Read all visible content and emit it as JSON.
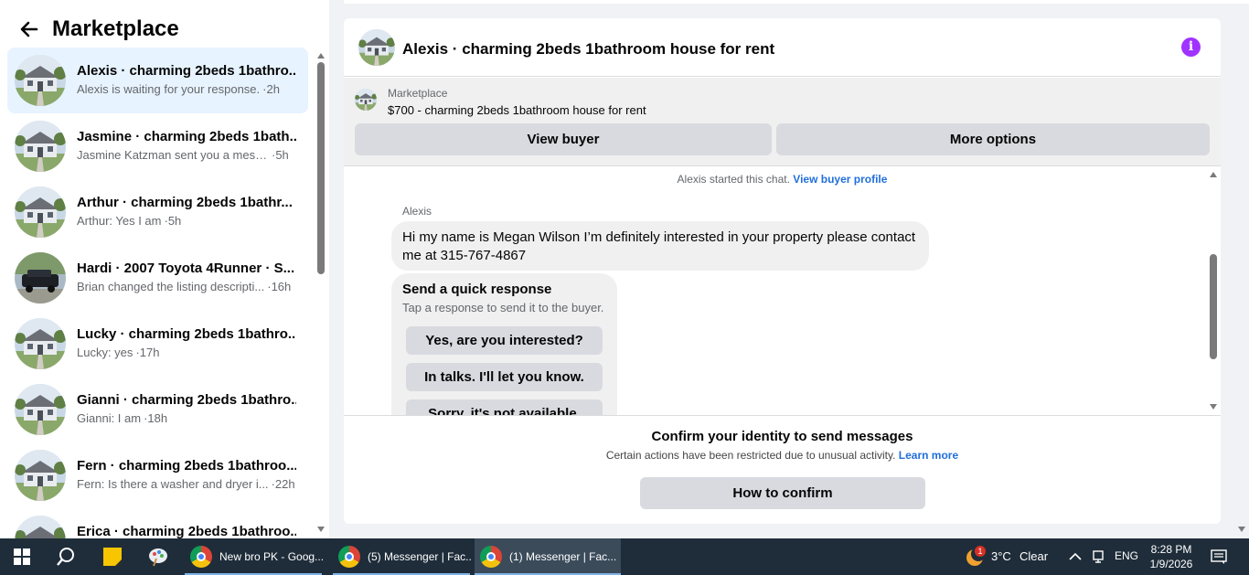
{
  "sidebar": {
    "title": "Marketplace",
    "conversations": [
      {
        "title": "Alexis · charming 2beds 1bathro...",
        "msg": "Alexis is waiting for your response.",
        "time": "·2h"
      },
      {
        "title": "Jasmine · charming 2beds 1bath...",
        "msg": "Jasmine Katzman sent you a messa...",
        "time": "·5h"
      },
      {
        "title": "Arthur · charming 2beds 1bathr...",
        "msg": "Arthur: Yes I am",
        "time": "·5h"
      },
      {
        "title": "Hardi · 2007 Toyota 4Runner · S...",
        "msg": "Brian changed the listing descripti...",
        "time": "·16h"
      },
      {
        "title": "Lucky · charming 2beds 1bathro...",
        "msg": "Lucky: yes",
        "time": "·17h"
      },
      {
        "title": "Gianni · charming 2beds 1bathro...",
        "msg": "Gianni: I am",
        "time": "·18h"
      },
      {
        "title": "Fern · charming 2beds 1bathroo...",
        "msg": "Fern: Is there a washer and dryer i...",
        "time": "·22h"
      },
      {
        "title": "Erica · charming 2beds 1bathroo...",
        "msg": "",
        "time": ""
      }
    ]
  },
  "chat": {
    "header_title": "Alexis · charming 2beds 1bathroom house for rent",
    "info_icon": "i",
    "listing": {
      "label": "Marketplace",
      "price_title": "$700 - charming 2beds 1bathroom house for rent",
      "view_buyer": "View buyer",
      "more_options": "More options"
    },
    "started_text": "Alexis started this chat.",
    "view_profile": "View buyer profile",
    "sender": "Alexis",
    "message": "Hi my name is Megan Wilson I’m definitely interested in your property please contact me at 315-767-4867",
    "quick": {
      "title": "Send a quick response",
      "subtitle": "Tap a response to send it to the buyer.",
      "options": [
        "Yes, are you interested?",
        "In talks. I'll let you know.",
        "Sorry, it's not available."
      ]
    },
    "confirm": {
      "title": "Confirm your identity to send messages",
      "subtitle": "Certain actions have been restricted due to unusual activity.",
      "learn_more": "Learn more",
      "button": "How to confirm"
    }
  },
  "taskbar": {
    "tasks": [
      "New bro PK - Goog...",
      "(5) Messenger | Fac...",
      "(1) Messenger | Fac..."
    ],
    "weather_badge": "1",
    "temperature": "3°C",
    "weather": "Clear",
    "language": "ENG",
    "time": "8:28 PM",
    "date": "1/9/2026"
  },
  "colors": {
    "accent_blue": "#216fdb",
    "active_conversation": "#e7f3ff",
    "info_purple": "#a033ff",
    "taskbar": "#1f2d3a"
  }
}
